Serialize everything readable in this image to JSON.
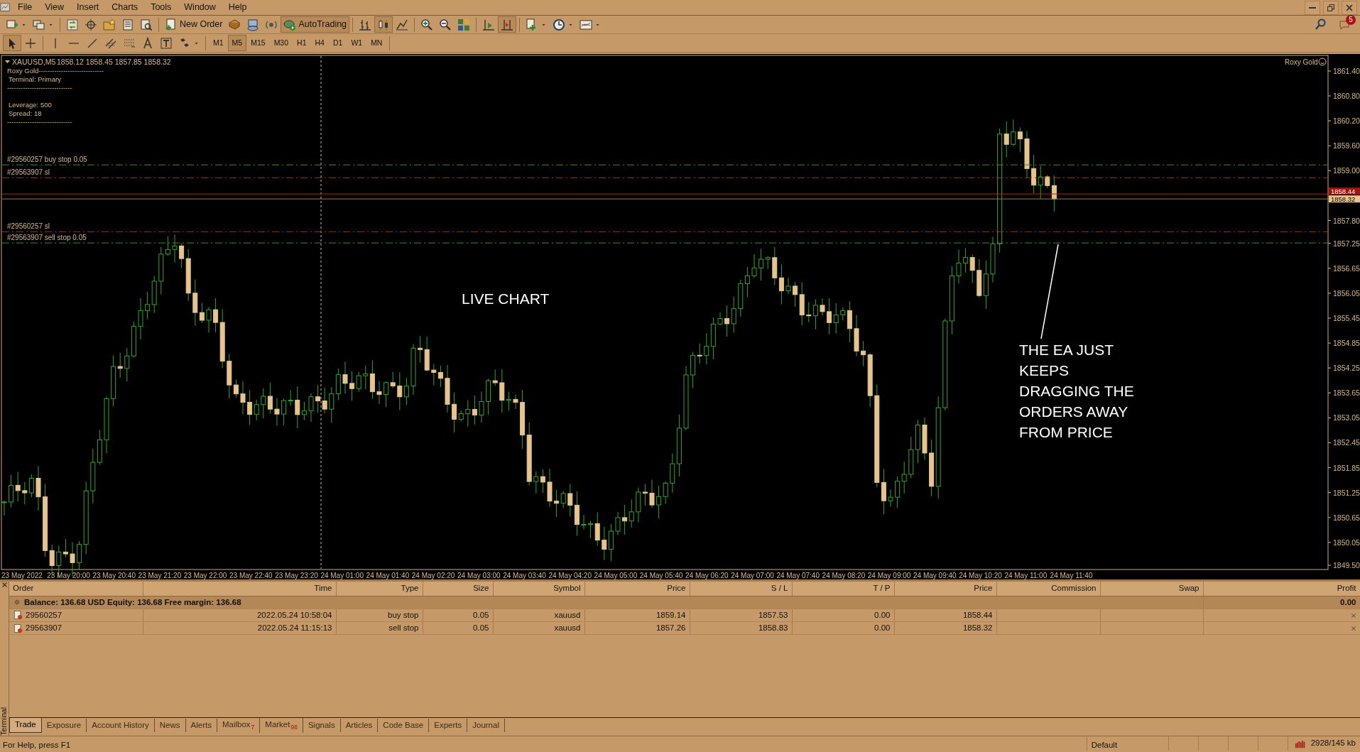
{
  "menu": [
    {
      "label": "File"
    },
    {
      "label": "View"
    },
    {
      "label": "Insert"
    },
    {
      "label": "Charts"
    },
    {
      "label": "Tools"
    },
    {
      "label": "Window"
    },
    {
      "label": "Help"
    }
  ],
  "toolbar": {
    "new_order": "New Order",
    "autotrading": {
      "label": "AutoTrading",
      "on": true
    }
  },
  "timeframes": [
    {
      "label": "M1",
      "selected": false
    },
    {
      "label": "M5",
      "selected": true
    },
    {
      "label": "M15",
      "selected": false
    },
    {
      "label": "M30",
      "selected": false
    },
    {
      "label": "H1",
      "selected": false
    },
    {
      "label": "H4",
      "selected": false
    },
    {
      "label": "D1",
      "selected": false
    },
    {
      "label": "W1",
      "selected": false
    },
    {
      "label": "MN",
      "selected": false
    }
  ],
  "notifications": {
    "count": "5"
  },
  "chart": {
    "symbol": "XAUUSD,M5",
    "ohlc": "1858.12 1858.45 1857.85 1858.32",
    "indicator_lines": [
      "Roxy Gold-----------------------------",
      "Terminal: Primary",
      "-----------------------------",
      "Leverage: 500",
      "Spread: 18",
      "-----------------------------"
    ],
    "indicator_name": "Roxy Gold",
    "price_labels": [
      "1861.40",
      "1860.80",
      "1860.20",
      "1859.60",
      "1859.00",
      "1857.80",
      "1857.25",
      "1856.65",
      "1856.05",
      "1855.45",
      "1854.85",
      "1854.25",
      "1853.65",
      "1853.05",
      "1852.45",
      "1851.85",
      "1851.25",
      "1850.65",
      "1850.05",
      "1849.50"
    ],
    "ask": "1858.44",
    "bid": "1858.32",
    "time_labels": [
      "23 May 2022",
      "23 May 20:00",
      "23 May 20:40",
      "23 May 21:20",
      "23 May 22:00",
      "23 May 22:40",
      "23 May 23:20",
      "24 May 01:00",
      "24 May 01:40",
      "24 May 02:20",
      "24 May 03:00",
      "24 May 03:40",
      "24 May 04:20",
      "24 May 05:00",
      "24 May 05:40",
      "24 May 06:20",
      "24 May 07:00",
      "24 May 07:40",
      "24 May 08:20",
      "24 May 09:00",
      "24 May 09:40",
      "24 May 10:20",
      "24 May 11:00",
      "24 May 11:40"
    ],
    "order_lines": [
      {
        "label": "#29560257 buy stop 0.05",
        "kind": "entry"
      },
      {
        "label": "#29563907 sl",
        "kind": "sl"
      },
      {
        "label": "#29560257 sl",
        "kind": "sl"
      },
      {
        "label": "#29563907 sell stop 0.05",
        "kind": "entry"
      }
    ],
    "annotations": [
      {
        "lines": [
          "LIVE CHART"
        ]
      },
      {
        "lines": [
          "THE EA JUST",
          "KEEPS",
          "DRAGGING THE",
          "ORDERS AWAY",
          "FROM PRICE"
        ]
      }
    ]
  },
  "terminal": {
    "title": "Terminal",
    "columns": [
      "Order",
      "Time",
      "Type",
      "Size",
      "Symbol",
      "Price",
      "S / L",
      "T / P",
      "Price",
      "Commission",
      "Swap",
      "Profit"
    ],
    "balance": "Balance: 136.68 USD  Equity: 136.68  Free margin: 136.68",
    "balance_profit": "0.00",
    "orders": [
      {
        "order": "29560257",
        "time": "2022.05.24 10:58:04",
        "type": "buy stop",
        "size": "0.05",
        "symbol": "xauusd",
        "price": "1859.14",
        "sl": "1857.53",
        "tp": "0.00",
        "current": "1858.44"
      },
      {
        "order": "29563907",
        "time": "2022.05.24 11:15:13",
        "type": "sell stop",
        "size": "0.05",
        "symbol": "xauusd",
        "price": "1857.26",
        "sl": "1858.83",
        "tp": "0.00",
        "current": "1858.32"
      }
    ],
    "tabs": [
      {
        "label": "Trade",
        "selected": true
      },
      {
        "label": "Exposure",
        "selected": false
      },
      {
        "label": "Account History",
        "selected": false
      },
      {
        "label": "News",
        "selected": false
      },
      {
        "label": "Alerts",
        "selected": false
      },
      {
        "label": "Mailbox",
        "badge": "7",
        "selected": false
      },
      {
        "label": "Market",
        "badge": "96",
        "selected": false
      },
      {
        "label": "Signals",
        "selected": false
      },
      {
        "label": "Articles",
        "selected": false
      },
      {
        "label": "Code Base",
        "selected": false
      },
      {
        "label": "Experts",
        "selected": false
      },
      {
        "label": "Journal",
        "selected": false
      }
    ]
  },
  "status_bar": {
    "help": "For Help, press F1",
    "profile": "Default",
    "traffic": "2928/145 kb"
  }
}
